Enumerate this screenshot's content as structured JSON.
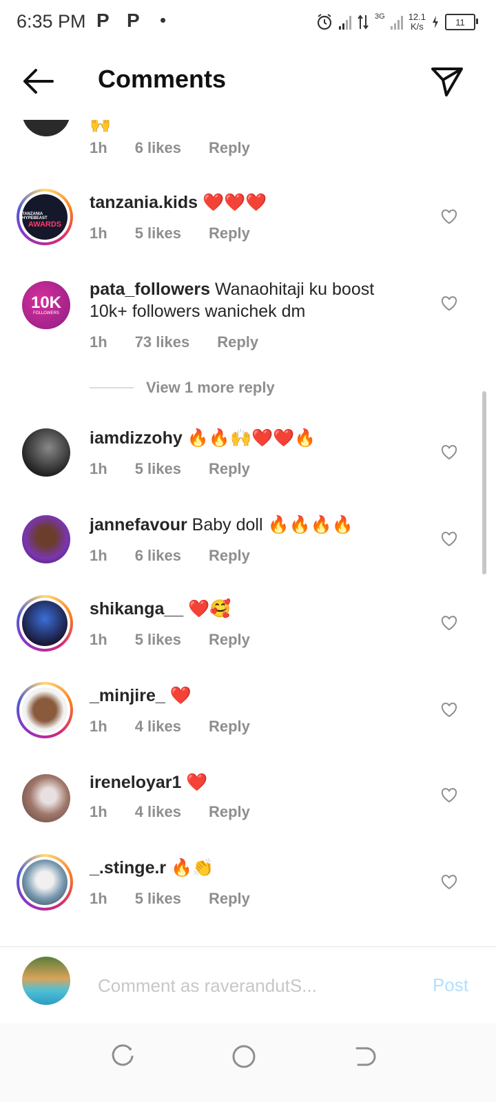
{
  "status_bar": {
    "time": "6:35 PM",
    "app_icon_1": "P",
    "app_icon_2": "P",
    "dot": "•",
    "network": "3G",
    "speed_top": "12.1",
    "speed_bottom": "K/s",
    "battery": "11"
  },
  "header": {
    "title": "Comments"
  },
  "comments": [
    {
      "emoji": "🙌",
      "time": "1h",
      "likes": "6 likes",
      "reply": "Reply"
    },
    {
      "username": "tanzania.kids",
      "text": "❤️❤️❤️",
      "time": "1h",
      "likes": "5 likes",
      "reply": "Reply",
      "avatar_text_1": "TANZANIA HYPEBEAST",
      "avatar_text_2": "AWARDS"
    },
    {
      "username": "pata_followers",
      "text": "Wanaohitaji ku boost 10k+ followers wanichek dm",
      "time": "1h",
      "likes": "73 likes",
      "reply": "Reply",
      "avatar_text_1": "10K",
      "avatar_text_2": "FOLLOWERS"
    },
    {
      "username": "iamdizzohy",
      "text": "🔥🔥🙌❤️❤️🔥",
      "time": "1h",
      "likes": "5 likes",
      "reply": "Reply"
    },
    {
      "username": "jannefavour",
      "text": "Baby doll 🔥🔥🔥🔥",
      "time": "1h",
      "likes": "6 likes",
      "reply": "Reply"
    },
    {
      "username": "shikanga__",
      "text": "❤️🥰",
      "time": "1h",
      "likes": "5 likes",
      "reply": "Reply"
    },
    {
      "username": "_minjire_",
      "text": "❤️",
      "time": "1h",
      "likes": "4 likes",
      "reply": "Reply"
    },
    {
      "username": "ireneloyar1",
      "text": "❤️",
      "time": "1h",
      "likes": "4 likes",
      "reply": "Reply"
    },
    {
      "username": "_.stinge.r",
      "text": "🔥👏",
      "time": "1h",
      "likes": "5 likes",
      "reply": "Reply"
    }
  ],
  "view_more": "View 1 more reply",
  "composer": {
    "placeholder": "Comment as raverandutS...",
    "post": "Post"
  },
  "colors": {
    "text": "#262626",
    "meta": "#8e8e8e",
    "post_disabled": "#b2dffc",
    "heart_red": "#ed4956"
  },
  "icons": [
    "back-arrow-icon",
    "direct-send-icon",
    "heart-icon",
    "recent-apps-icon",
    "home-icon",
    "back-nav-icon",
    "alarm-icon",
    "signal-icon",
    "data-arrows-icon",
    "charging-icon"
  ]
}
